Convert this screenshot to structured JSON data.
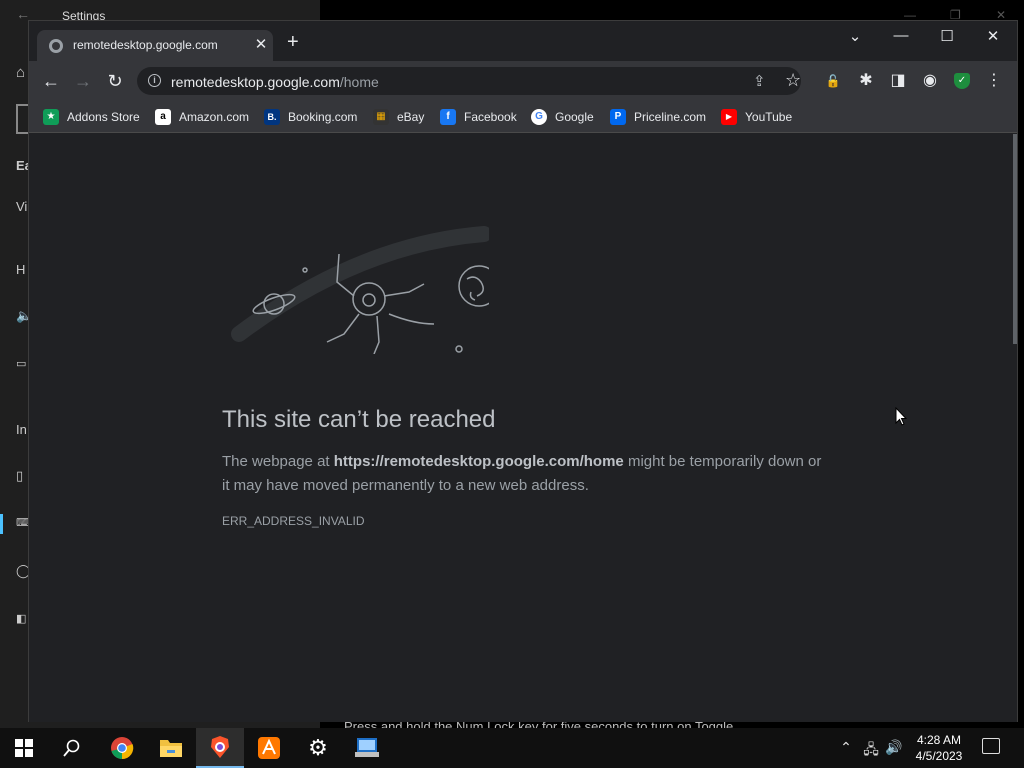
{
  "settings": {
    "title": "Settings",
    "back_icon": "back-arrow-icon",
    "fragments": [
      "Ea",
      "Vi",
      "H",
      "In"
    ],
    "bottom_text": "Press and hold the Num Lock key for five seconds to turn on Toggle"
  },
  "browser": {
    "tab": {
      "title": "remotedesktop.google.com",
      "favicon": "globe-icon"
    },
    "window_controls": {
      "tab_search": "⌄",
      "minimize": "—",
      "maximize": "☐",
      "close": "✕"
    },
    "omnibox": {
      "host": "remotedesktop.google.com",
      "path": "/home"
    },
    "bookmarks": [
      {
        "label": "Addons Store",
        "icon": "addons-store-icon",
        "color": "#0f9d58",
        "glyph": "★"
      },
      {
        "label": "Amazon.com",
        "icon": "amazon-icon",
        "color": "#ffffff",
        "glyph": "a"
      },
      {
        "label": "Booking.com",
        "icon": "booking-icon",
        "color": "#003580",
        "glyph": "B."
      },
      {
        "label": "eBay",
        "icon": "ebay-icon",
        "color": "#333333",
        "glyph": "▦"
      },
      {
        "label": "Facebook",
        "icon": "facebook-icon",
        "color": "#1877f2",
        "glyph": "f"
      },
      {
        "label": "Google",
        "icon": "google-icon",
        "color": "#ffffff",
        "glyph": "G"
      },
      {
        "label": "Priceline.com",
        "icon": "priceline-icon",
        "color": "#0068ef",
        "glyph": "P"
      },
      {
        "label": "YouTube",
        "icon": "youtube-icon",
        "color": "#ff0000",
        "glyph": "▶"
      }
    ]
  },
  "error_page": {
    "title": "This site can’t be reached",
    "desc_prefix": "The webpage at ",
    "desc_url": "https://remotedesktop.google.com/home",
    "desc_suffix": " might be temporarily down or it may have moved permanently to a new web address.",
    "code": "ERR_ADDRESS_INVALID"
  },
  "taskbar": {
    "apps": [
      "start-icon",
      "search-icon",
      "chrome-icon",
      "file-explorer-icon",
      "brave-icon",
      "avast-icon",
      "settings-icon",
      "remote-desktop-icon"
    ],
    "time": "4:28 AM",
    "date": "4/5/2023"
  },
  "colors": {
    "accent": "#4cc2ff",
    "chrome_bg": "#202124",
    "toolbar": "#35363a"
  }
}
